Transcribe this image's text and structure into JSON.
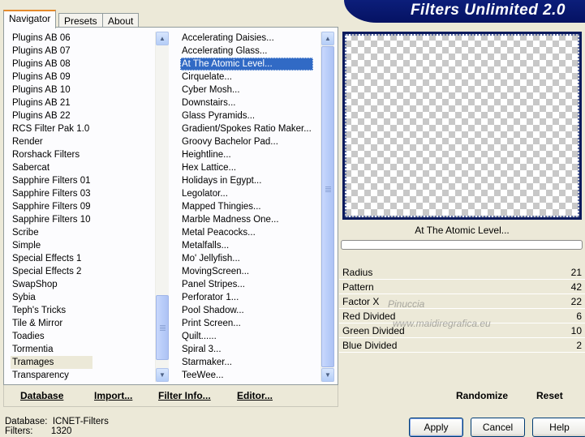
{
  "tabs": [
    "Navigator",
    "Presets",
    "About"
  ],
  "app_title": "Filters Unlimited 2.0",
  "categories": [
    "Plugins AB 06",
    "Plugins AB 07",
    "Plugins AB 08",
    "Plugins AB 09",
    "Plugins AB 10",
    "Plugins AB 21",
    "Plugins AB 22",
    "RCS Filter Pak 1.0",
    "Render",
    "Rorshack Filters",
    "Sabercat",
    "Sapphire Filters 01",
    "Sapphire Filters 03",
    "Sapphire Filters 09",
    "Sapphire Filters 10",
    "Scribe",
    "Simple",
    "Special Effects 1",
    "Special Effects 2",
    "SwapShop",
    "Sybia",
    "Teph's Tricks",
    "Tile & Mirror",
    "Toadies",
    "Tormentia",
    "Tramages",
    "Transparency"
  ],
  "selected_category": "Tramages",
  "filters": [
    "Accelerating Daisies...",
    "Accelerating Glass...",
    "At The Atomic Level...",
    "Cirquelate...",
    "Cyber Mosh...",
    "Downstairs...",
    "Glass Pyramids...",
    "Gradient/Spokes Ratio Maker...",
    "Groovy Bachelor Pad...",
    "Heightline...",
    "Hex Lattice...",
    "Holidays in Egypt...",
    "Legolator...",
    "Mapped Thingies...",
    "Marble Madness One...",
    "Metal Peacocks...",
    "Metalfalls...",
    "Mo' Jellyfish...",
    "MovingScreen...",
    "Panel Stripes...",
    "Perforator 1...",
    "Pool Shadow...",
    "Print Screen...",
    "Quilt......",
    "Spiral 3...",
    "Starmaker...",
    "TeeWee..."
  ],
  "selected_filter": "At The Atomic Level...",
  "toolbar": {
    "database": "Database",
    "import": "Import...",
    "filter_info": "Filter Info...",
    "editor": "Editor...",
    "randomize": "Randomize",
    "reset": "Reset"
  },
  "preview_filter_name": "At The Atomic Level...",
  "params": [
    {
      "label": "Radius",
      "value": "21"
    },
    {
      "label": "Pattern",
      "value": "42"
    },
    {
      "label": "Factor X",
      "value": "22"
    },
    {
      "label": "Red Divided",
      "value": "6"
    },
    {
      "label": "Green Divided",
      "value": "10"
    },
    {
      "label": "Blue Divided",
      "value": "2"
    }
  ],
  "watermark": {
    "line1": "Pinuccia",
    "line2": "www.maidiregrafica.eu"
  },
  "footer": {
    "database_label": "Database:",
    "database_value": "ICNET-Filters",
    "filters_label": "Filters:",
    "filters_value": "1320"
  },
  "buttons": {
    "apply": "Apply",
    "cancel": "Cancel",
    "help": "Help"
  }
}
